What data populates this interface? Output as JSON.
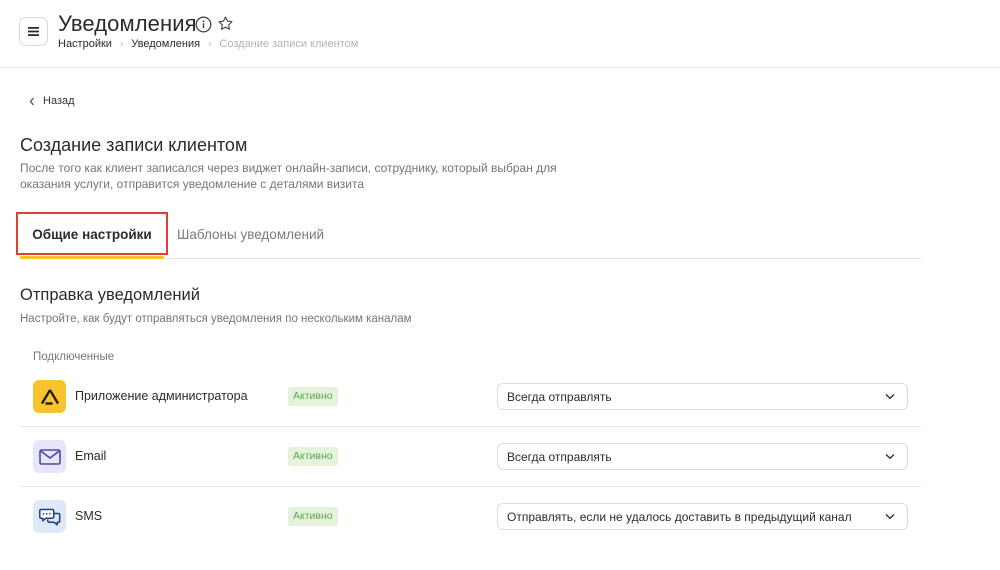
{
  "header": {
    "title": "Уведомления",
    "breadcrumbs": [
      "Настройки",
      "Уведомления",
      "Создание записи клиентом"
    ]
  },
  "back_label": "Назад",
  "page": {
    "heading": "Создание записи клиентом",
    "description": "После того как клиент записался через виджет онлайн-записи, сотруднику, который выбран для оказания услуги, отправится уведомление с деталями визита"
  },
  "tabs": [
    {
      "label": "Общие настройки",
      "active": true
    },
    {
      "label": "Шаблоны уведомлений",
      "active": false
    }
  ],
  "section": {
    "heading": "Отправка уведомлений",
    "description": "Настройте, как будут отправляться уведомления по нескольким каналам",
    "group_label": "Подключенные"
  },
  "channels": [
    {
      "name": "Приложение администратора",
      "status": "Активно",
      "option": "Всегда отправлять",
      "icon": "admin-app-icon",
      "icon_bg": "#f7c430"
    },
    {
      "name": "Email",
      "status": "Активно",
      "option": "Всегда отправлять",
      "icon": "mail-icon",
      "icon_bg": "#e6e6fa"
    },
    {
      "name": "SMS",
      "status": "Активно",
      "option": "Отправлять, если не удалось доставить в предыдущий канал",
      "icon": "sms-chat-icon",
      "icon_bg": "#dde8f8"
    }
  ],
  "colors": {
    "accent": "#f7c430",
    "active_badge_bg": "#e5f3dc",
    "active_badge_text": "#56a84a",
    "highlight_border": "#e23c33"
  }
}
